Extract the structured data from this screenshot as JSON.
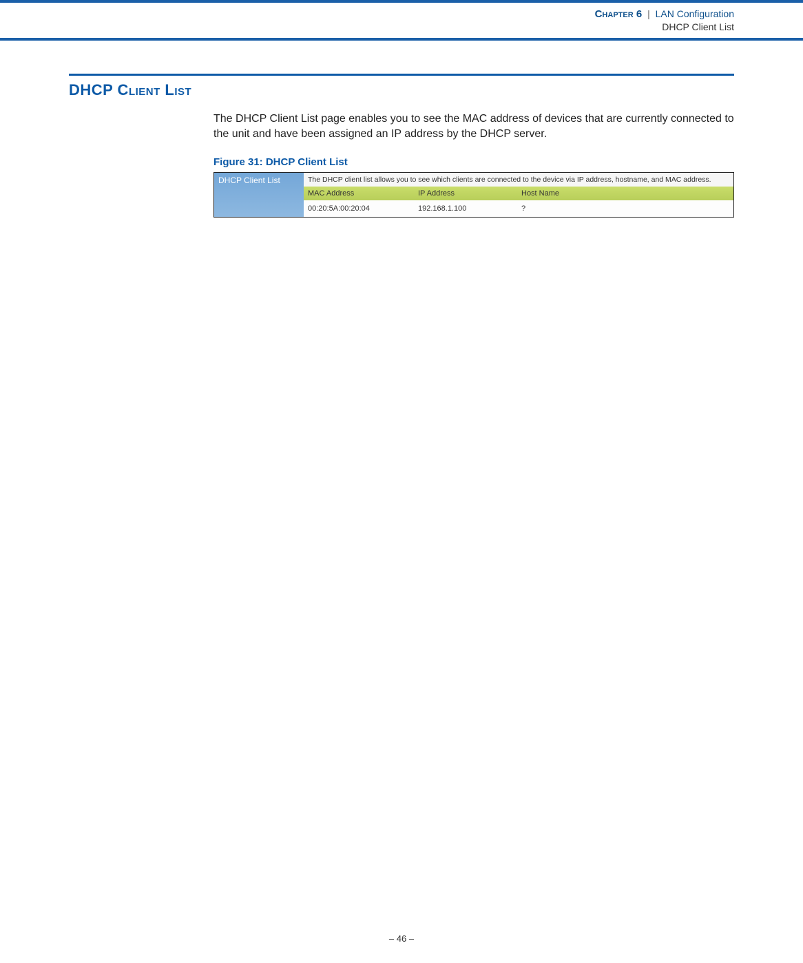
{
  "header": {
    "chapter_label": "Chapter 6",
    "separator": "|",
    "chapter_title": "LAN Configuration",
    "sub_title": "DHCP Client List"
  },
  "section": {
    "heading": "DHCP Client List",
    "body": "The DHCP Client List page enables you to see the MAC address of devices that are currently connected to the unit and have been assigned an IP address by the DHCP server."
  },
  "figure": {
    "caption": "Figure 31:  DHCP Client List",
    "sidebar_title": "DHCP Client List",
    "description": "The DHCP client list allows you to see which clients are connected to the device via IP address, hostname, and MAC address.",
    "columns": {
      "mac": "MAC Address",
      "ip": "IP Address",
      "host": "Host Name"
    },
    "rows": [
      {
        "mac": "00:20:5A:00:20:04",
        "ip": "192.168.1.100",
        "host": "?"
      }
    ]
  },
  "footer": {
    "page": "–  46  –"
  }
}
